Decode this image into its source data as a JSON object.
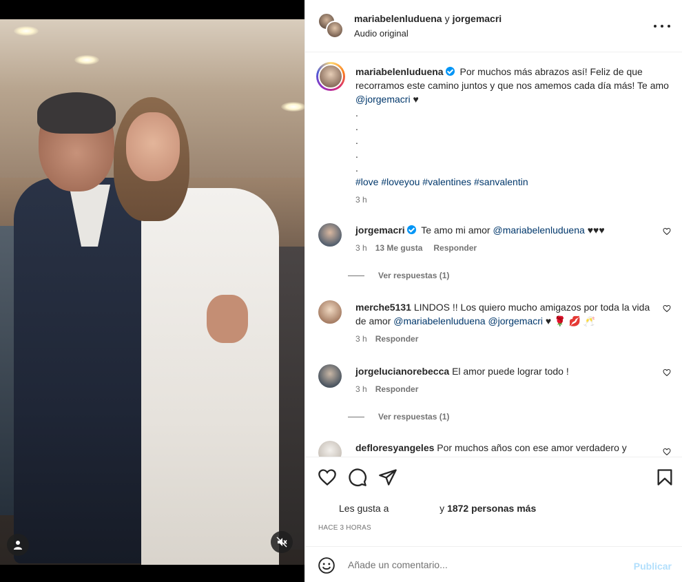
{
  "post": {
    "header": {
      "user1": "mariabelenluduena",
      "joiner": "y",
      "user2": "jorgemacri",
      "subtitle": "Audio original"
    },
    "caption": {
      "username": "mariabelenluduena",
      "text": "Por muchos más abrazos así! Feliz de que recorramos este camino juntos y que nos amemos cada día más! Te amo",
      "mention": "@jorgemacri",
      "heart": "♥",
      "dots": [
        ".",
        ".",
        ".",
        ".",
        "."
      ],
      "hashtags": "#love #loveyou #valentines #sanvalentin",
      "time": "3 h"
    },
    "comments": [
      {
        "username": "jorgemacri",
        "verified": true,
        "text": "Te amo mi amor",
        "mention": "@mariabelenluduena",
        "suffix": "♥♥♥",
        "time": "3 h",
        "likes": "13 Me gusta",
        "reply": "Responder",
        "view_replies": "Ver respuestas (1)"
      },
      {
        "username": "merche5131",
        "text": "LINDOS !! Los quiero mucho amigazos por toda la vida de amor",
        "mention1": "@mariabelenluduena",
        "mention2": "@jorgemacri",
        "suffix": "♥ 🌹 💋 🥂",
        "time": "3 h",
        "reply": "Responder"
      },
      {
        "username": "jorgelucianorebecca",
        "text": "El amor puede lograr todo !",
        "time": "3 h",
        "reply": "Responder",
        "view_replies": "Ver respuestas (1)"
      },
      {
        "username": "defloresyangeles",
        "text": "Por muchos años con ese amor verdadero y"
      }
    ],
    "likes": {
      "prefix": "Les gusta a",
      "joiner": "y",
      "count": "1872 personas más"
    },
    "time_ago": "HACE 3 HORAS",
    "comment_box": {
      "placeholder": "Añade un comentario...",
      "publish": "Publicar"
    }
  },
  "icons": [
    "user-icon",
    "mute-icon",
    "more-icon",
    "heart-icon",
    "comment-icon",
    "share-icon",
    "save-icon",
    "emoji-icon"
  ],
  "colors": {
    "link": "#00376b",
    "verified": "#0095f6",
    "muted": "#737373",
    "publish_disabled": "#b2dffc"
  }
}
